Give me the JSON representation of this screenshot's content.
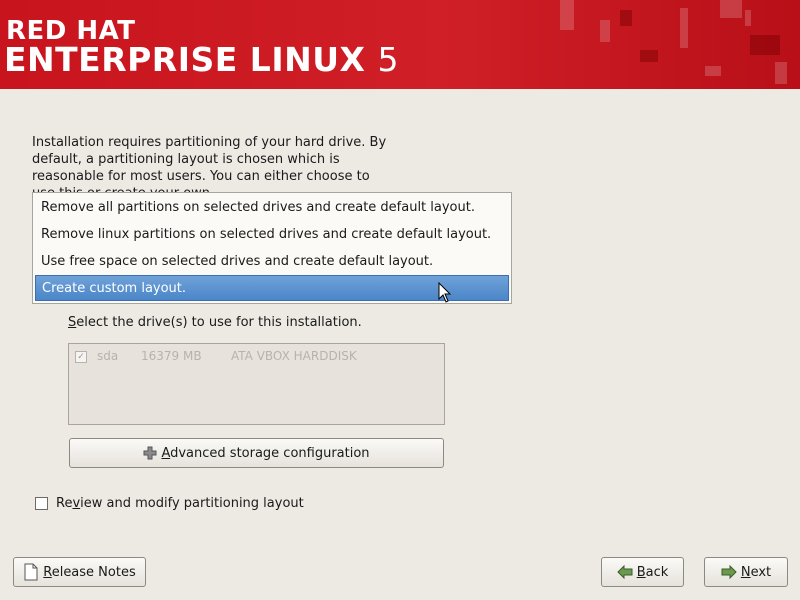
{
  "header": {
    "brand_line1": "RED HAT",
    "brand_line2": "ENTERPRISE LINUX",
    "version": "5"
  },
  "intro": {
    "text": "Installation requires partitioning of your hard drive. By default, a partitioning layout is chosen which is reasonable for most users.  You can either choose to use this or create your own."
  },
  "partition_options": {
    "items": [
      "Remove all partitions on selected drives and create default layout.",
      "Remove linux partitions on selected drives and create default layout.",
      "Use free space on selected drives and create default layout.",
      "Create custom layout."
    ],
    "selected": "Create custom layout."
  },
  "drives": {
    "label_prefix": "S",
    "label_rest": "elect the drive(s) to use for this installation.",
    "rows": [
      {
        "checked": true,
        "name": "sda",
        "size": "16379 MB",
        "model": "ATA VBOX HARDDISK"
      }
    ]
  },
  "advanced_button": {
    "prefix": "",
    "underline": "A",
    "rest": "dvanced storage configuration"
  },
  "review": {
    "prefix": "Re",
    "underline": "v",
    "rest": "iew and modify partitioning layout",
    "checked": false
  },
  "footer": {
    "release_notes": {
      "underline": "R",
      "rest": "elease Notes"
    },
    "back": {
      "underline": "B",
      "rest": "ack"
    },
    "next": {
      "underline": "N",
      "rest": "ext"
    }
  },
  "colors": {
    "banner": "#c8141d",
    "selection": "#4b86c8",
    "background": "#edeae4"
  }
}
